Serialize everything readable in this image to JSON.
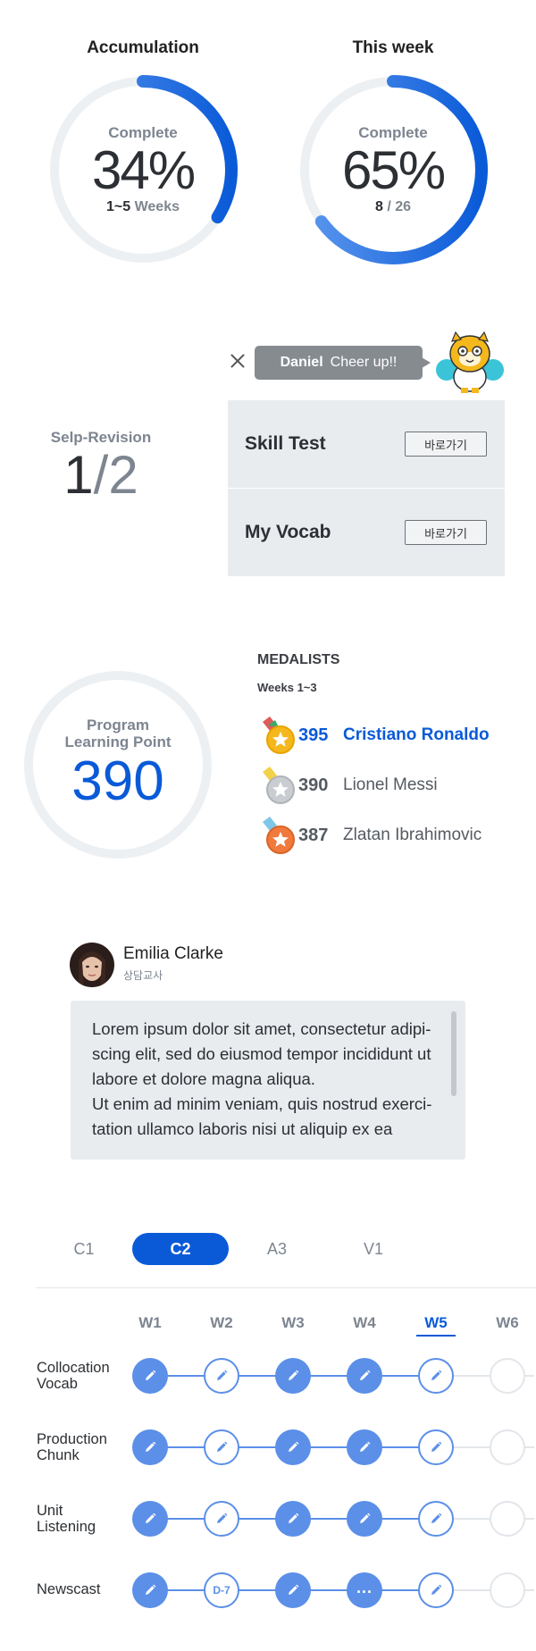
{
  "progress": {
    "accumulation": {
      "title": "Accumulation",
      "label": "Complete",
      "percent_text": "34%",
      "percent": 34,
      "sub_bold": "1~5",
      "sub_rest": " Weeks"
    },
    "this_week": {
      "title": "This week",
      "label": "Complete",
      "percent_text": "65%",
      "percent": 65,
      "sub_bold": "8",
      "sub_rest": " / 26"
    }
  },
  "cheer": {
    "name": "Daniel",
    "message": "Cheer up!!"
  },
  "revision": {
    "label": "Selp-Revision",
    "done": "1",
    "slash": "/",
    "total": "2"
  },
  "quick_links": [
    {
      "title": "Skill Test",
      "button": "바로가기"
    },
    {
      "title": "My Vocab",
      "button": "바로가기"
    }
  ],
  "learning_point": {
    "label": "Program\nLearning Point",
    "value": "390"
  },
  "medalists": {
    "heading": "MEDALISTS",
    "range": "Weeks 1~3",
    "entries": [
      {
        "score": "395",
        "name": "Cristiano Ronaldo",
        "medal": "gold"
      },
      {
        "score": "390",
        "name": "Lionel Messi",
        "medal": "silver"
      },
      {
        "score": "387",
        "name": "Zlatan Ibrahimovic",
        "medal": "bronze"
      }
    ]
  },
  "teacher": {
    "name": "Emilia Clarke",
    "role": "상담교사",
    "message": "Lorem ipsum dolor sit amet, consectetur adipi-\nscing elit, sed do eiusmod tempor incididunt ut\nlabore et dolore magna aliqua.\nUt enim ad minim veniam, quis nostrud exerci-\ntation ullamco laboris nisi ut aliquip ex ea"
  },
  "courses": {
    "tabs": [
      "C1",
      "C2",
      "A3",
      "V1"
    ],
    "active": "C2"
  },
  "schedule": {
    "weeks": [
      "W1",
      "W2",
      "W3",
      "W4",
      "W5",
      "W6"
    ],
    "current_week": "W5",
    "rows": [
      {
        "label": "Collocation\nVocab",
        "states": [
          "done",
          "open",
          "done",
          "done",
          "current",
          "locked"
        ],
        "texts": [
          "",
          "",
          "",
          "",
          "",
          ""
        ]
      },
      {
        "label": "Production\nChunk",
        "states": [
          "done",
          "open",
          "done",
          "done",
          "current",
          "locked"
        ],
        "texts": [
          "",
          "",
          "",
          "",
          "",
          ""
        ]
      },
      {
        "label": "Unit\nListening",
        "states": [
          "done",
          "open",
          "done",
          "done",
          "current",
          "locked"
        ],
        "texts": [
          "",
          "",
          "",
          "",
          "",
          ""
        ]
      },
      {
        "label": "Newscast",
        "states": [
          "done",
          "countdown",
          "done",
          "in-progress",
          "current",
          "locked"
        ],
        "texts": [
          "",
          "D-7",
          "",
          "",
          "",
          ""
        ]
      }
    ]
  },
  "colors": {
    "accent": "#0a5ad8",
    "node": "#5b8fe8",
    "muted": "#7d8590",
    "panel": "#e9ecef"
  }
}
